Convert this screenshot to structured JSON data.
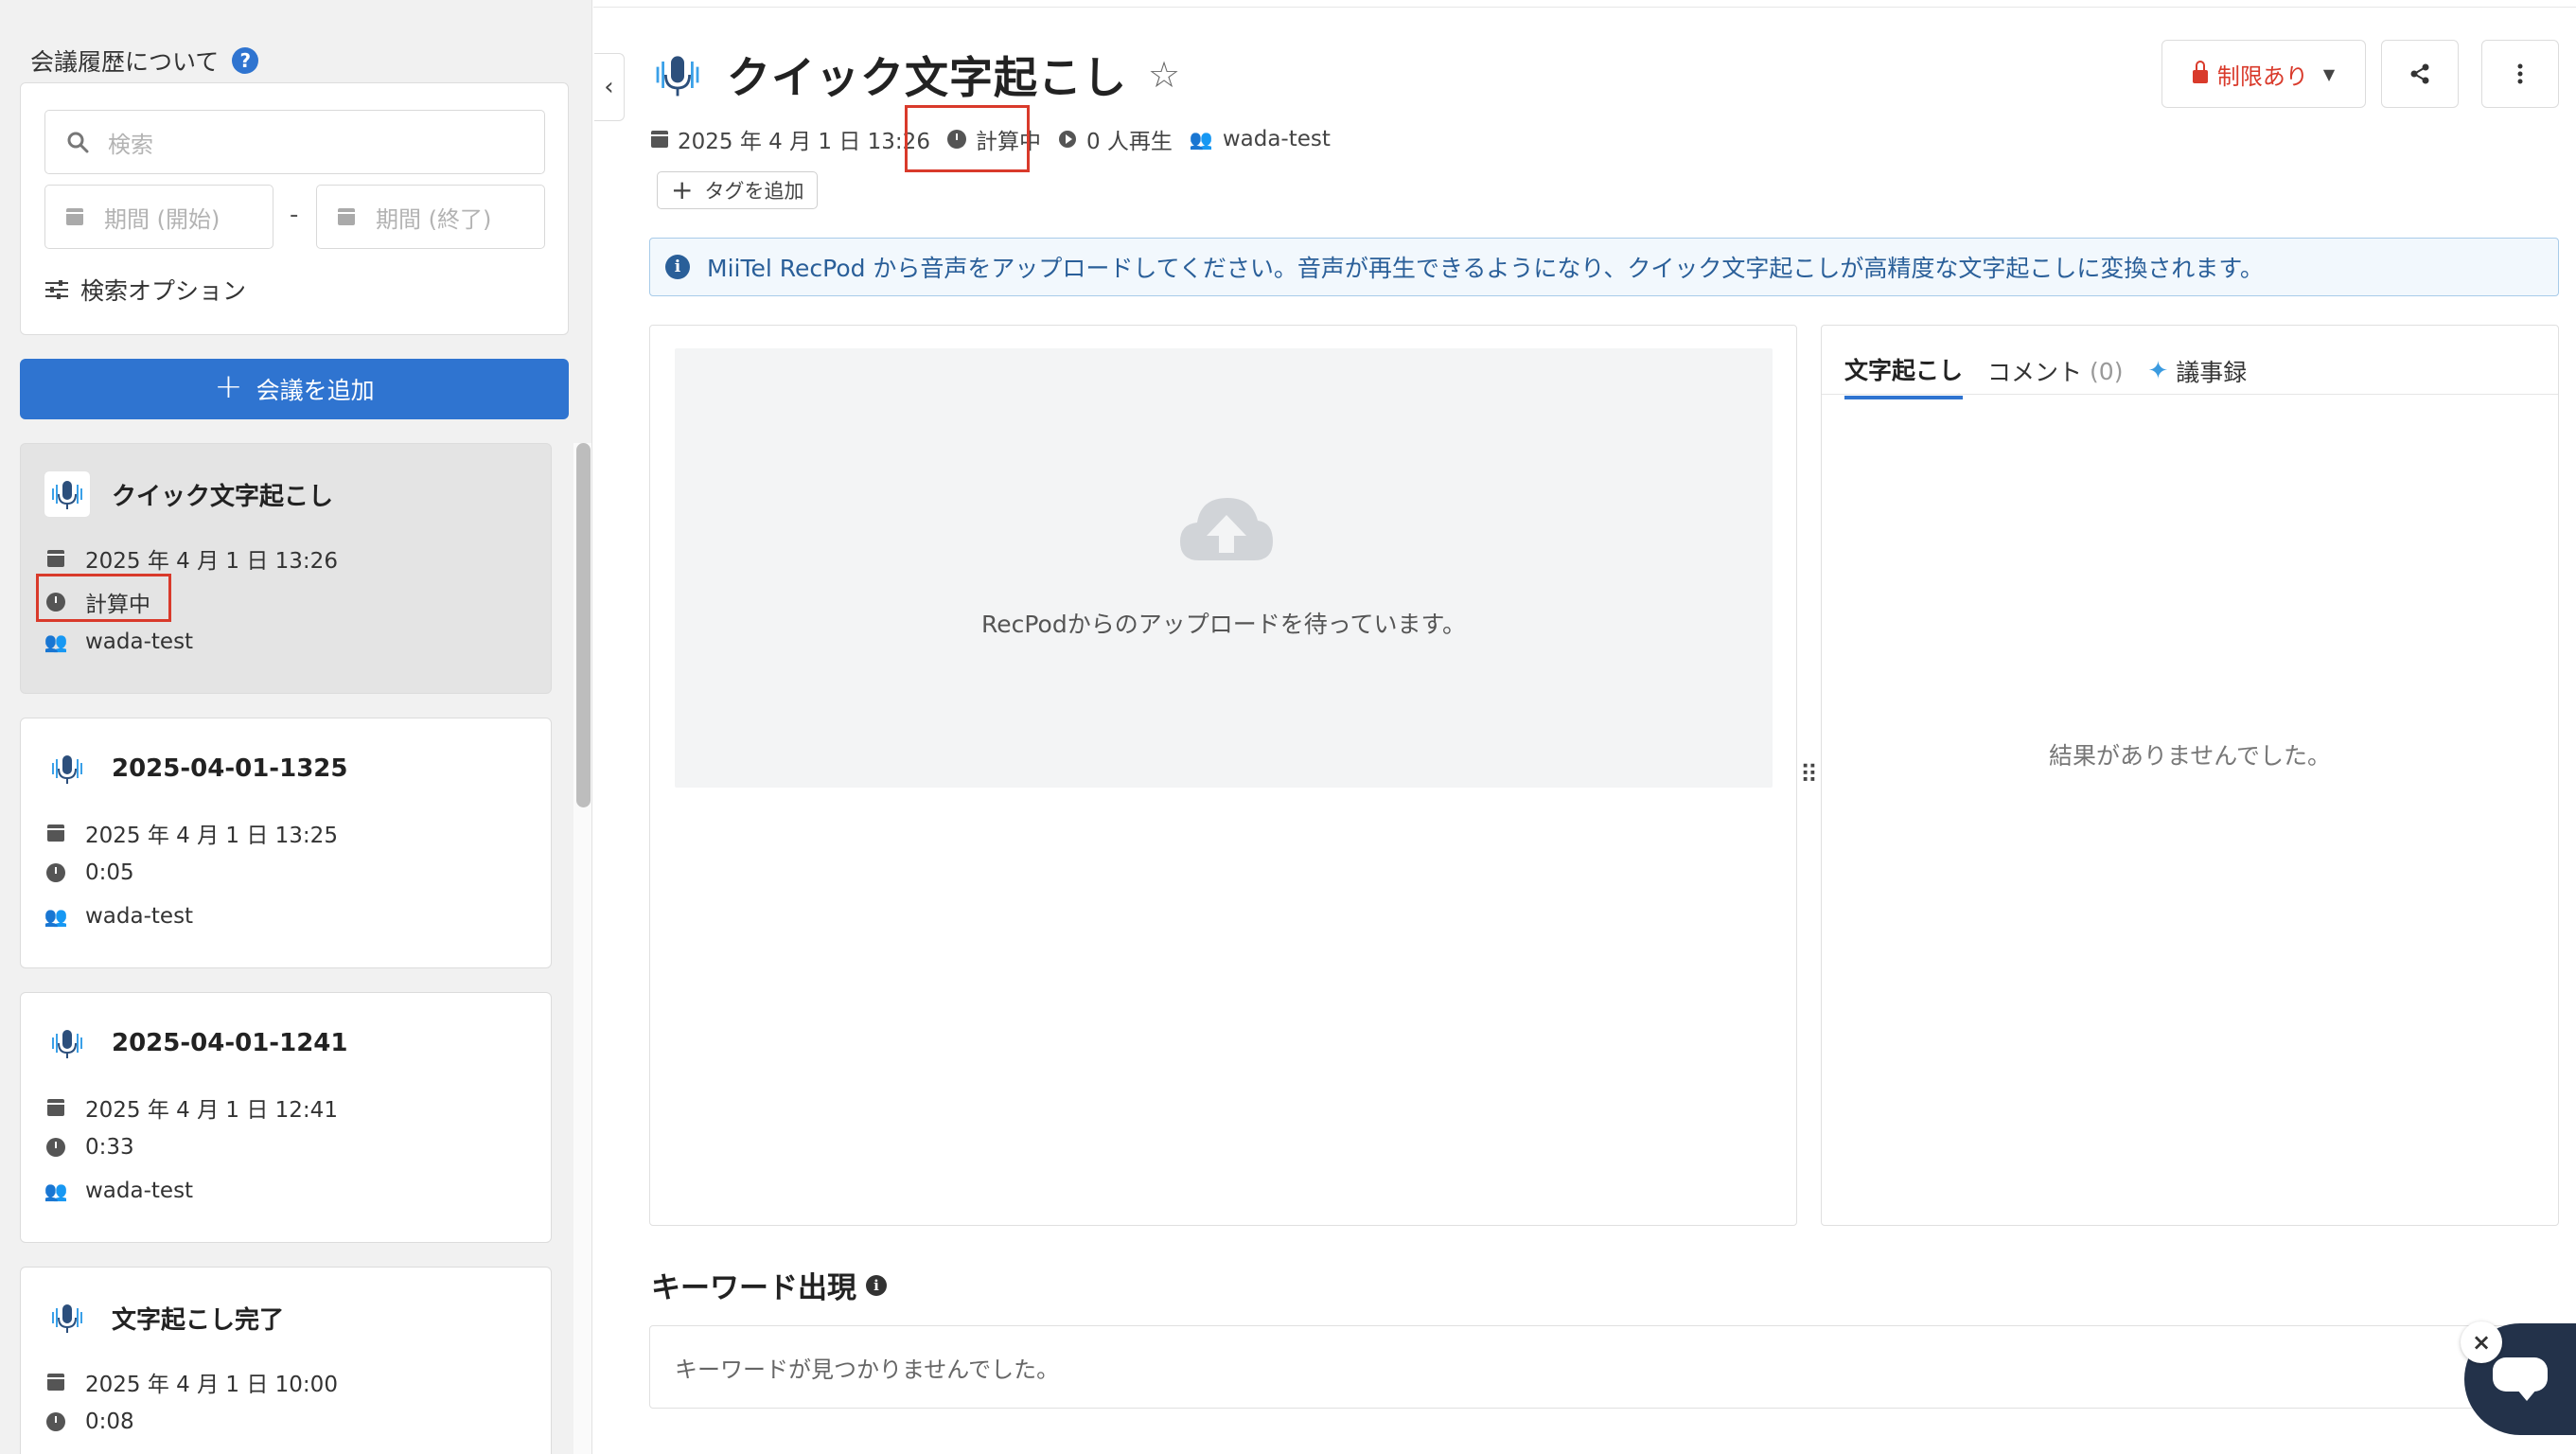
{
  "sidebar": {
    "heading": "会議履歴について",
    "help_icon": "?",
    "search": {
      "placeholder": "検索"
    },
    "date_start_placeholder": "期間 (開始)",
    "date_end_placeholder": "期間 (終了)",
    "date_separator": "-",
    "search_options_label": "検索オプション",
    "add_button_label": "会議を追加",
    "meetings": [
      {
        "title": "クイック文字起こし",
        "date": "2025 年 4 月 1 日 13:26",
        "duration": "計算中",
        "owner": "wada-test",
        "active": true
      },
      {
        "title": "2025-04-01-1325",
        "date": "2025 年 4 月 1 日 13:25",
        "duration": "0:05",
        "owner": "wada-test",
        "active": false
      },
      {
        "title": "2025-04-01-1241",
        "date": "2025 年 4 月 1 日 12:41",
        "duration": "0:33",
        "owner": "wada-test",
        "active": false
      },
      {
        "title": "文字起こし完了",
        "date": "2025 年 4 月 1 日 10:00",
        "duration": "0:08",
        "owner": "wada-test",
        "active": false
      }
    ]
  },
  "main": {
    "title": "クイック文字起こし",
    "meta": {
      "date": "2025 年 4 月 1 日 13:26",
      "duration": "計算中",
      "plays": "0 人再生",
      "owner": "wada-test"
    },
    "add_tag_label": "タグを追加",
    "restriction_label": "制限あり",
    "info_banner": "MiiTel RecPod から音声をアップロードしてください。音声が再生できるようになり、クイック文字起こしが高精度な文字起こしに変換されます。",
    "upload_waiting": "RecPodからのアップロードを待っています。",
    "tabs": [
      {
        "label": "文字起こし",
        "active": true
      },
      {
        "label": "コメント",
        "count": "(0)",
        "active": false
      },
      {
        "label": "議事録",
        "active": false
      }
    ],
    "empty_result": "結果がありませんでした。",
    "keywords_heading": "キーワード出現",
    "keywords_empty": "キーワードが見つかりませんでした。"
  },
  "colors": {
    "primary": "#2f74d0",
    "highlight": "#d93a2b",
    "restriction": "#d93a2b",
    "info_text": "#2a5f99",
    "chat": "#23324a"
  }
}
